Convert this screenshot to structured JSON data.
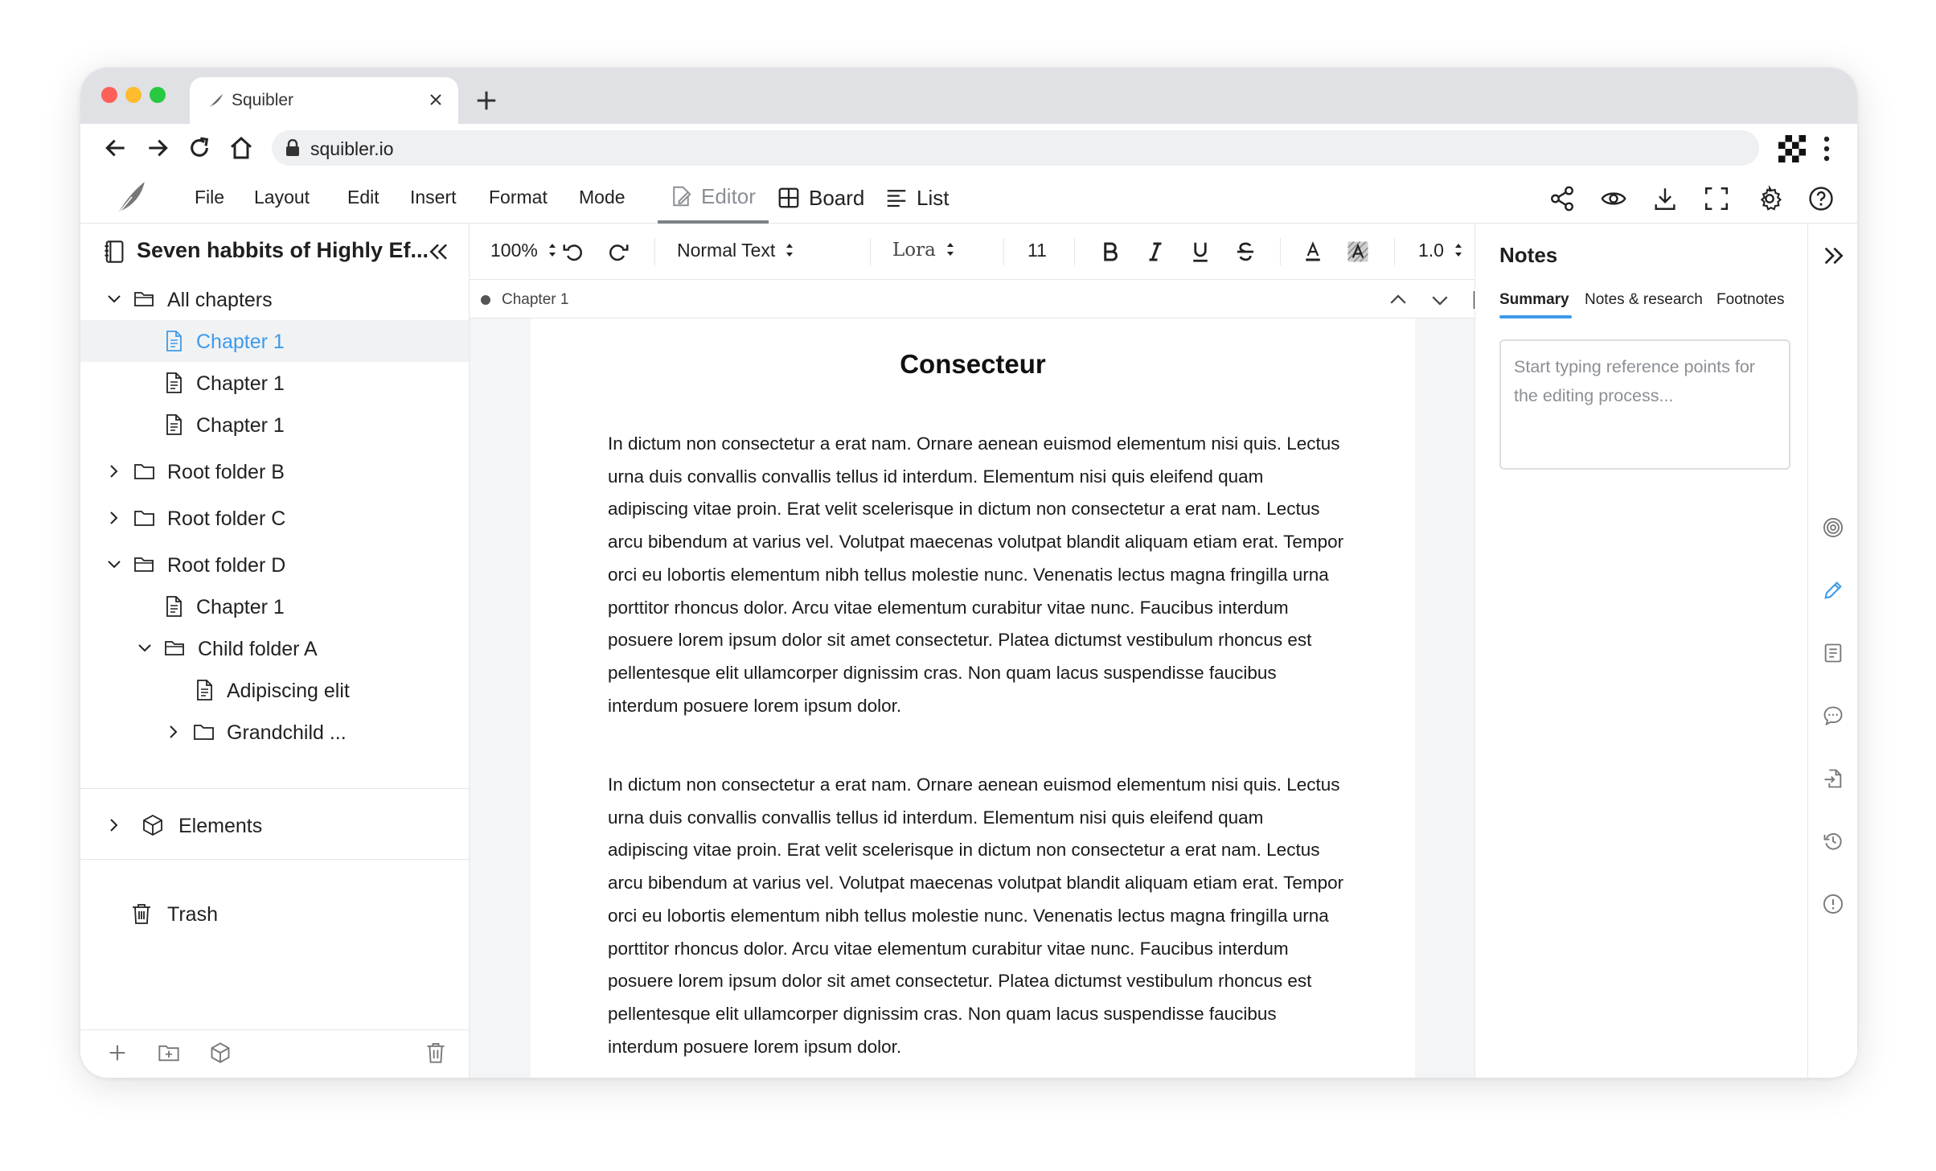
{
  "browser": {
    "tab_title": "Squibler",
    "url": "squibler.io"
  },
  "menu": {
    "items": [
      "File",
      "Layout",
      "Edit",
      "Insert",
      "Format",
      "Mode"
    ],
    "modes": [
      "Editor",
      "Board",
      "List"
    ],
    "active_mode": "Editor"
  },
  "sidebar": {
    "book_title": "Seven habbits of Highly Ef...",
    "tree": [
      {
        "label": "All chapters",
        "type": "folder",
        "expanded": true
      },
      {
        "label": "Chapter 1",
        "type": "doc",
        "selected": true
      },
      {
        "label": "Chapter 1",
        "type": "doc"
      },
      {
        "label": "Chapter 1",
        "type": "doc"
      },
      {
        "label": "Root folder B",
        "type": "folder",
        "expanded": false
      },
      {
        "label": "Root folder C",
        "type": "folder",
        "expanded": false
      },
      {
        "label": "Root folder D",
        "type": "folder",
        "expanded": true
      },
      {
        "label": "Chapter 1",
        "type": "doc"
      },
      {
        "label": "Child folder A",
        "type": "folder",
        "expanded": true
      },
      {
        "label": "Adipiscing elit",
        "type": "doc"
      },
      {
        "label": "Grandchild ...",
        "type": "folder",
        "expanded": false
      }
    ],
    "elements_label": "Elements",
    "trash_label": "Trash"
  },
  "toolbar": {
    "zoom": "100%",
    "style": "Normal Text",
    "font": "Lora",
    "size": "11",
    "line_spacing": "1.0"
  },
  "document": {
    "breadcrumb": "Chapter 1",
    "title": "Consecteur",
    "paragraphs": [
      "In dictum non consectetur a erat nam. Ornare aenean euismod elementum nisi quis. Lectus urna duis convallis convallis tellus id interdum. Elementum nisi quis eleifend quam adipiscing vitae proin. Erat velit scelerisque in dictum non consectetur a erat nam. Lectus arcu bibendum at varius vel. Volutpat maecenas volutpat blandit aliquam etiam erat. Tempor orci eu lobortis elementum nibh tellus molestie nunc. Venenatis lectus magna fringilla urna porttitor rhoncus dolor. Arcu vitae elementum curabitur vitae nunc. Faucibus interdum posuere lorem ipsum dolor sit amet consectetur. Platea dictumst vestibulum rhoncus est pellentesque elit ullamcorper dignissim cras. Non quam lacus suspendisse faucibus interdum posuere lorem ipsum dolor.",
      "In dictum non consectetur a erat nam. Ornare aenean euismod elementum nisi quis. Lectus urna duis convallis convallis tellus id interdum. Elementum nisi quis eleifend quam adipiscing vitae proin. Erat velit scelerisque in dictum non consectetur a erat nam. Lectus arcu bibendum at varius vel. Volutpat maecenas volutpat blandit aliquam etiam erat. Tempor orci eu lobortis elementum nibh tellus molestie nunc. Venenatis lectus magna fringilla urna porttitor rhoncus dolor. Arcu vitae elementum curabitur vitae nunc. Faucibus interdum posuere lorem ipsum dolor sit amet consectetur. Platea dictumst vestibulum rhoncus est pellentesque elit ullamcorper dignissim cras. Non quam lacus suspendisse faucibus interdum posuere lorem ipsum dolor."
    ]
  },
  "notes": {
    "title": "Notes",
    "tabs": [
      "Summary",
      "Notes & research",
      "Footnotes"
    ],
    "active_tab": "Summary",
    "placeholder": "Start typing reference points for the editing process..."
  },
  "colors": {
    "accent": "#3d9be9",
    "selected_bg": "#f1f2f4",
    "muted_text": "#8b8f95"
  }
}
